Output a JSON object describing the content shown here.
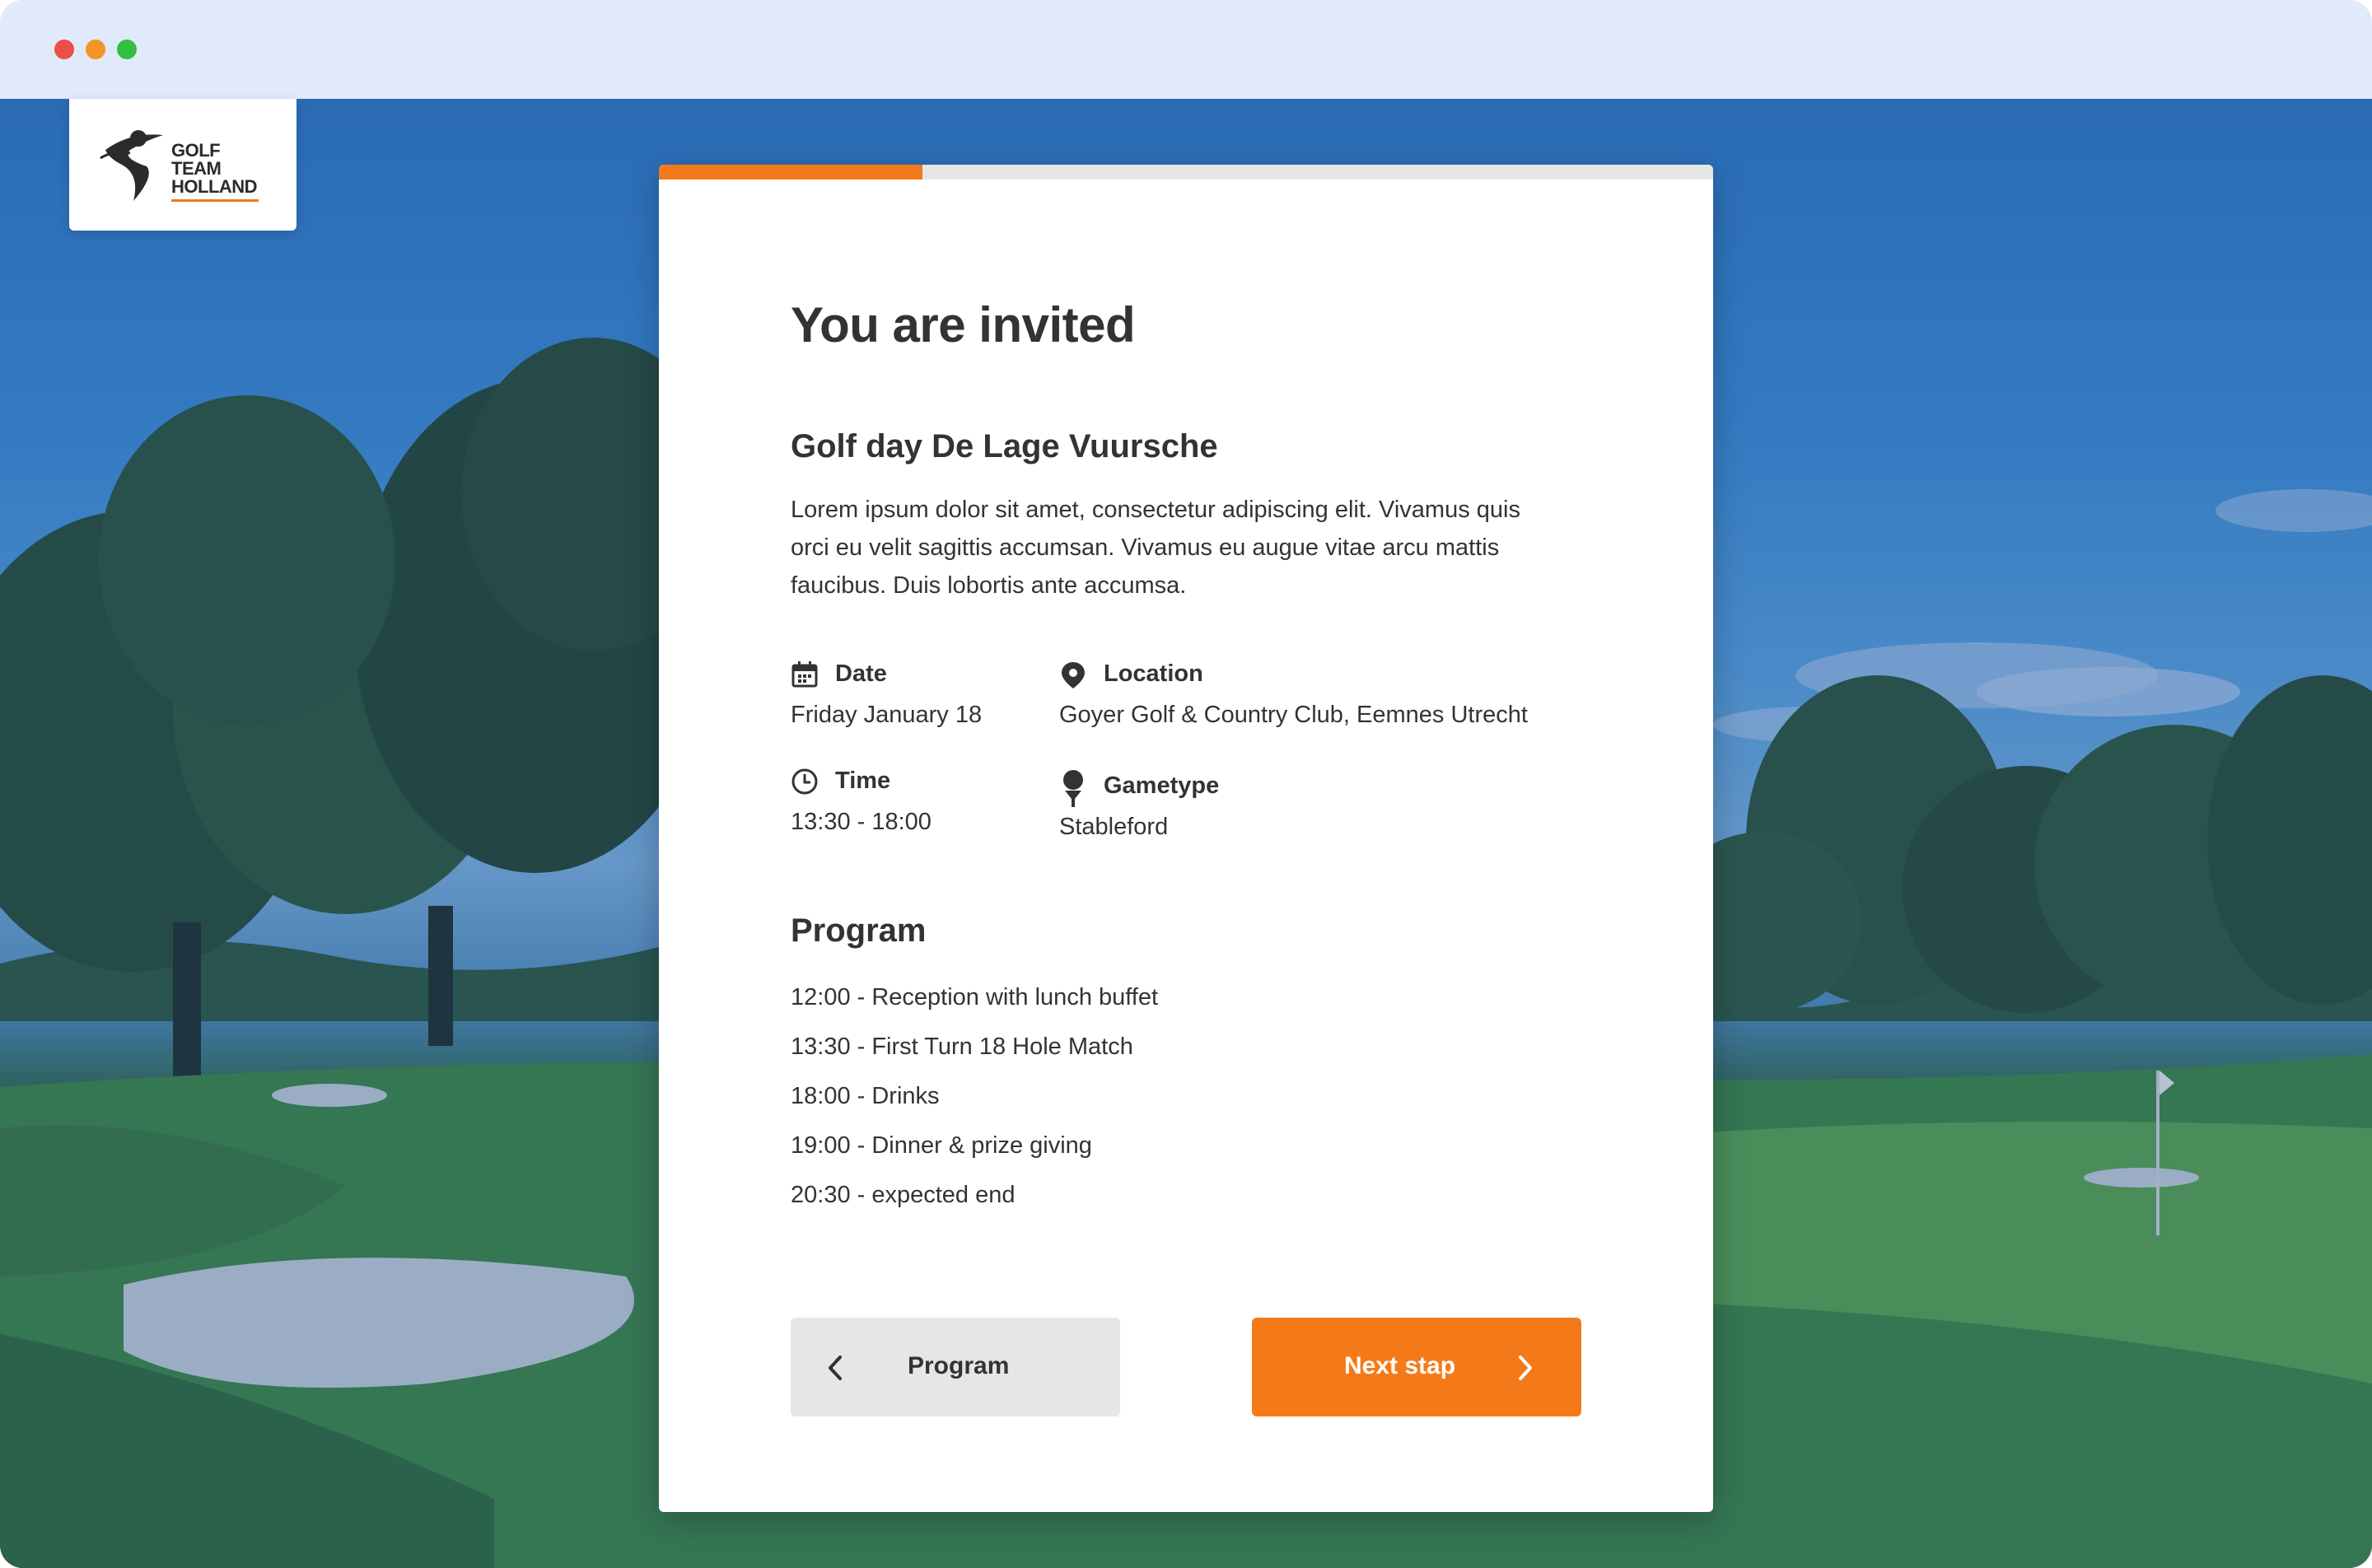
{
  "brand": {
    "logo_lines": [
      "GOLF",
      "TEAM",
      "HOLLAND"
    ],
    "accent_color": "#f47a19"
  },
  "progress": {
    "fraction": 0.25
  },
  "invite": {
    "heading": "You are invited",
    "event_title": "Golf day De Lage Vuursche",
    "description": "Lorem ipsum dolor sit amet, consectetur adipiscing elit. Vivamus quis orci eu velit sagittis accumsan. Vivamus eu augue vitae arcu mattis faucibus. Duis lobortis ante accumsa."
  },
  "details": {
    "date": {
      "label": "Date",
      "value": "Friday January 18",
      "icon": "calendar-icon"
    },
    "location": {
      "label": "Location",
      "value": "Goyer Golf & Country Club, Eemnes Utrecht",
      "icon": "map-pin-icon"
    },
    "time": {
      "label": "Time",
      "value": "13:30 - 18:00",
      "icon": "clock-icon"
    },
    "gametype": {
      "label": "Gametype",
      "value": "Stableford",
      "icon": "golf-tee-icon"
    }
  },
  "program": {
    "title": "Program",
    "items": [
      "12:00 - Reception with lunch buffet",
      "13:30 - First Turn 18 Hole Match",
      "18:00 - Drinks",
      "19:00 - Dinner & prize giving",
      "20:30 - expected end"
    ]
  },
  "buttons": {
    "prev_label": "Program",
    "next_label": "Next stap"
  }
}
